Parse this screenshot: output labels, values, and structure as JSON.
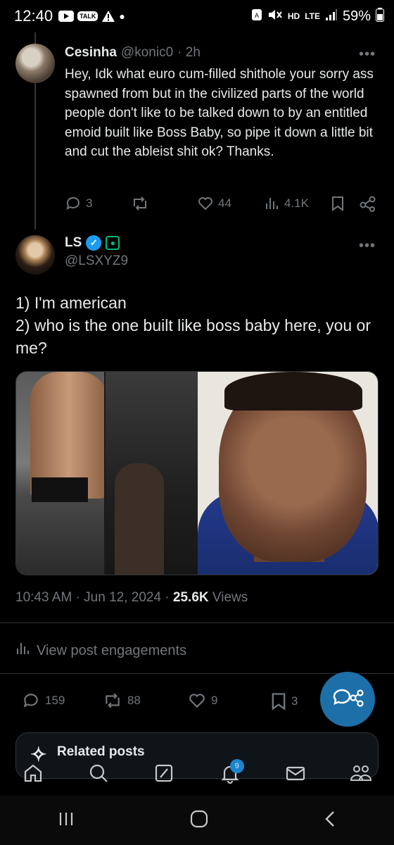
{
  "status_bar": {
    "time": "12:40",
    "talk": "TALK",
    "hd": "HD",
    "lte": "LTE",
    "battery": "59%"
  },
  "reply": {
    "name": "Cesinha",
    "handle": "@konic0",
    "time": "· 2h",
    "text": "Hey, Idk what euro cum-filled shithole your sorry ass spawned from but in the civilized parts of the world people don't like to be talked down to by an entitled emoid built like Boss Baby, so pipe it down a little bit and cut the ableist shit ok? Thanks.",
    "replies": "3",
    "likes": "44",
    "views": "4.1K"
  },
  "post": {
    "name": "LS",
    "handle": "@LSXYZ9",
    "line1": "1) I'm american",
    "line2": "2) who is the one built like boss baby here, you or me?",
    "timestamp": "10:43 AM · Jun 12, 2024 · ",
    "views_count": "25.6K",
    "views_label": " Views",
    "engagements": "View post engagements",
    "replies": "159",
    "reposts": "88",
    "likes": "9",
    "bookmarks": "3"
  },
  "more_label": "•••",
  "related": {
    "label": "Related posts"
  },
  "tabs": {
    "notif_count": "9"
  },
  "colors": {
    "accent": "#1d9bf0",
    "muted": "#71767b",
    "text": "#e7e9ea",
    "green_badge": "#00ba7c"
  }
}
